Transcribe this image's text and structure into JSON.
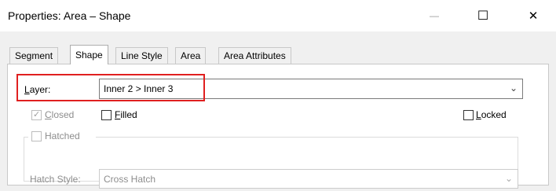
{
  "window": {
    "title": "Properties: Area – Shape",
    "minimize": "—",
    "maximize": "☐",
    "close": "✕"
  },
  "tabs": [
    {
      "label": "Segment",
      "active": false
    },
    {
      "label": "Shape",
      "active": true
    },
    {
      "label": "Line Style",
      "active": false
    },
    {
      "label": "Area",
      "active": false
    },
    {
      "label": "Area Attributes",
      "active": false
    }
  ],
  "layer": {
    "label_mnemonic": "L",
    "label_rest": "ayer:",
    "value": "Inner 2 > Inner 3"
  },
  "closed": {
    "label_mnemonic": "C",
    "label_rest": "losed",
    "checked": true,
    "enabled": false
  },
  "filled": {
    "label_mnemonic": "F",
    "label_rest": "illed",
    "checked": false,
    "enabled": true
  },
  "locked": {
    "label_mnemonic": "L",
    "label_rest": "ocked",
    "checked": false,
    "enabled": true
  },
  "hatched": {
    "label": "Hatched",
    "checked": false,
    "enabled": false
  },
  "hatch_style": {
    "label": "Hatch Style:",
    "value": "Cross Hatch",
    "enabled": false
  },
  "colors": {
    "highlight": "#e02020",
    "dialog_bg": "#f0f0f0"
  }
}
